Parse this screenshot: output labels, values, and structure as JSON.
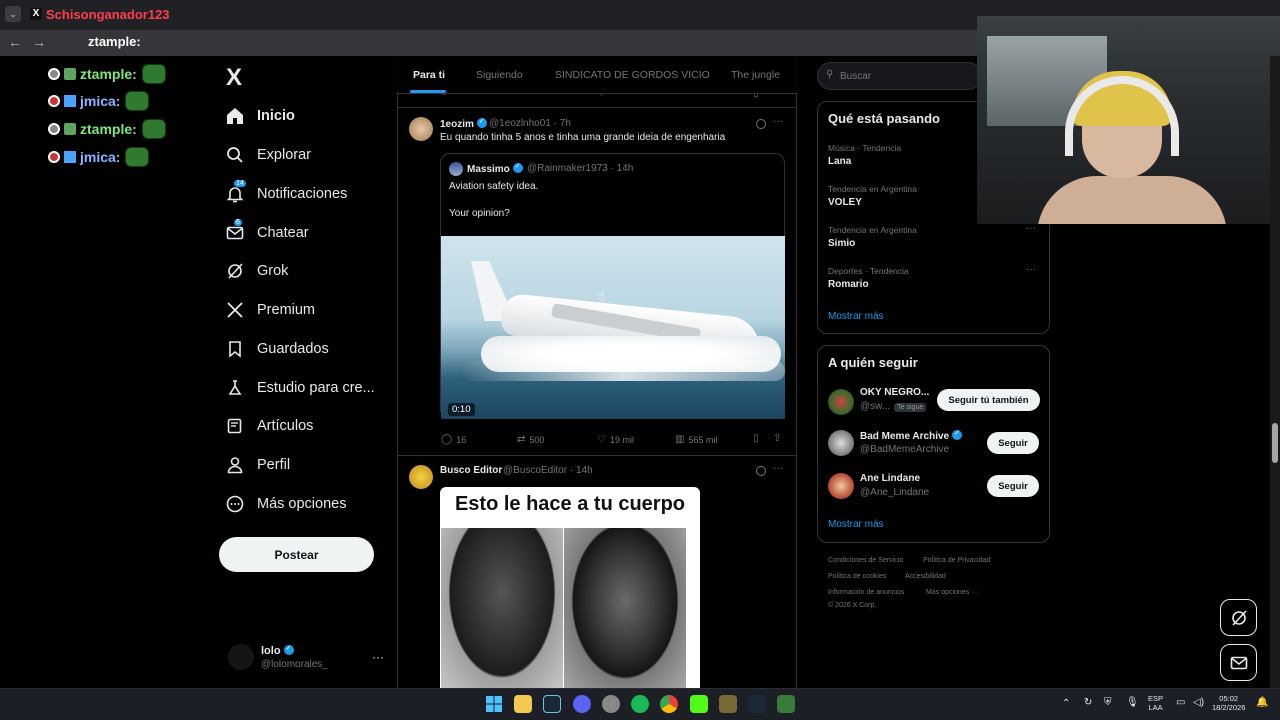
{
  "browser": {
    "tab_title": "Schisonganador123",
    "tab_icon": "x-logo-icon",
    "address_overlay": "ztample:"
  },
  "stream_chat": [
    {
      "user": "ztample:",
      "color": "#7de87d"
    },
    {
      "user": "jmica:",
      "color": "#8ab4ff"
    },
    {
      "user": "ztample:",
      "color": "#7de87d"
    },
    {
      "user": "jmica:",
      "color": "#8ab4ff"
    }
  ],
  "sidebar": {
    "logo": "X",
    "items": [
      {
        "label": "Inicio",
        "icon": "home-icon",
        "active": true
      },
      {
        "label": "Explorar",
        "icon": "search-icon"
      },
      {
        "label": "Notificaciones",
        "icon": "bell-icon",
        "badge": "14"
      },
      {
        "label": "Chatear",
        "icon": "mail-icon",
        "badge": "6"
      },
      {
        "label": "Grok",
        "icon": "grok-icon"
      },
      {
        "label": "Premium",
        "icon": "x-premium-icon"
      },
      {
        "label": "Guardados",
        "icon": "bookmark-icon"
      },
      {
        "label": "Estudio para cre...",
        "icon": "studio-icon"
      },
      {
        "label": "Artículos",
        "icon": "article-icon"
      },
      {
        "label": "Perfil",
        "icon": "person-icon"
      },
      {
        "label": "Más opciones",
        "icon": "more-circle-icon"
      }
    ],
    "post_button": "Postear",
    "account": {
      "name": "lolo",
      "handle": "@lolomorales_",
      "more": "···"
    }
  },
  "tabs": [
    {
      "label": "Para ti",
      "active": true
    },
    {
      "label": "Siguiendo"
    },
    {
      "label": "SINDICATO DE GORDOS VICIO"
    },
    {
      "label": "The jungle"
    }
  ],
  "tweets": [
    {
      "name": "1eozim",
      "handle": "@1eozlnho01",
      "time": "· 7h",
      "text": "Eu quando tinha 5 anos e tinha uma grande ideia de engenharia",
      "quote": {
        "name": "Massimo",
        "handle": "@Rainmaker1973",
        "time": "· 14h",
        "line1": "Aviation safety idea.",
        "line2": "Your opinion?",
        "video_time": "0:10"
      },
      "replies": "16",
      "reposts": "500",
      "likes": "19 mil",
      "views": "565 mil"
    },
    {
      "name": "Busco Editor",
      "handle": "@BuscoEditor",
      "time": "· 14h",
      "image_caption": "Esto le hace a tu cuerpo"
    }
  ],
  "search": {
    "placeholder": "Buscar"
  },
  "trends": {
    "title": "Qué está pasando",
    "items": [
      {
        "meta": "Música · Tendencia",
        "name": "Lana"
      },
      {
        "meta": "Tendencia en Argentina",
        "name": "VOLEY"
      },
      {
        "meta": "Tendencia en Argentina",
        "name": "Simio"
      },
      {
        "meta": "Deportes · Tendencia",
        "name": "Romario"
      }
    ],
    "more": "···",
    "show_more": "Mostrar más"
  },
  "who_to_follow": {
    "title": "A quién seguir",
    "items": [
      {
        "name": "OKY NEGRO...",
        "handle": "@sw...",
        "follows_you": "Te sigue",
        "button": "Seguir tú también"
      },
      {
        "name": "Bad Meme Archive",
        "handle": "@BadMemeArchive",
        "verified": true,
        "button": "Seguir"
      },
      {
        "name": "Ane Lindane",
        "handle": "@Ane_Lindane",
        "button": "Seguir"
      }
    ],
    "show_more": "Mostrar más"
  },
  "footer": {
    "links": [
      "Condiciones de Servicio",
      "Política de Privacidad",
      "Política de cookies",
      "Accesibilidad",
      "Información de anuncios",
      "Más opciones ···"
    ],
    "copyright": "© 2026 X Corp."
  },
  "taskbar": {
    "lang_top": "ESP",
    "lang_bottom": "LAA",
    "time": "05:02",
    "date": "18/2/2026"
  },
  "colors": {
    "accent": "#1d9bf0",
    "bg": "#000000",
    "border": "#2f3336",
    "muted": "#71767b"
  }
}
